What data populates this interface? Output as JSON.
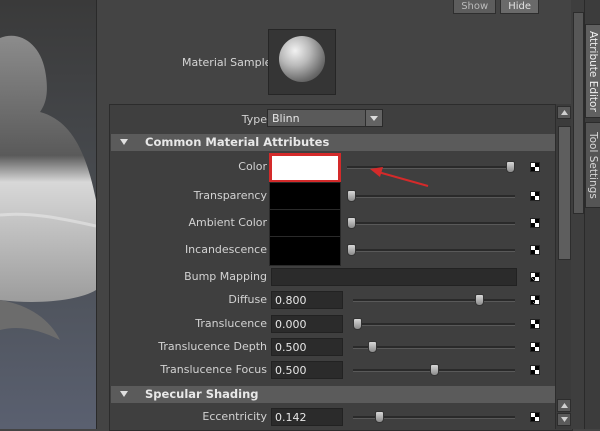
{
  "window": {
    "show_button": "Show",
    "hide_button": "Hide"
  },
  "material_sample": {
    "label": "Material Sample"
  },
  "type_field": {
    "label": "Type",
    "value": "Blinn"
  },
  "sections": {
    "common": "Common Material Attributes",
    "specular": "Specular Shading"
  },
  "attributes": [
    {
      "label": "Color",
      "kind": "swatch",
      "swatch_color": "#ffffff",
      "slider": 1.0,
      "highlighted": true
    },
    {
      "label": "Transparency",
      "kind": "swatch",
      "swatch_color": "#000000",
      "slider": 0.0
    },
    {
      "label": "Ambient Color",
      "kind": "swatch",
      "swatch_color": "#000000",
      "slider": 0.0
    },
    {
      "label": "Incandescence",
      "kind": "swatch",
      "swatch_color": "#000000",
      "slider": 0.0
    },
    {
      "label": "Bump Mapping",
      "kind": "field"
    },
    {
      "label": "Diffuse",
      "kind": "number",
      "value": "0.800",
      "slider": 0.8
    },
    {
      "label": "Translucence",
      "kind": "number",
      "value": "0.000",
      "slider": 0.0
    },
    {
      "label": "Translucence Depth",
      "kind": "number",
      "value": "0.500",
      "slider": 0.1
    },
    {
      "label": "Translucence Focus",
      "kind": "number",
      "value": "0.500",
      "slider": 0.5
    }
  ],
  "specular_attributes": [
    {
      "label": "Eccentricity",
      "kind": "number",
      "value": "0.142",
      "slider": 0.142
    }
  ],
  "side_tabs": {
    "attribute_editor": "Attribute Editor",
    "tool_settings": "Tool Settings"
  },
  "colors": {
    "highlight_red": "#d42a2a",
    "panel_bg": "#444444"
  },
  "icons": [
    "dropdown-arrow-icon",
    "collapse-triangle-icon",
    "map-checker-icon",
    "scroll-up-icon",
    "scroll-down-icon",
    "annotation-arrow-icon"
  ]
}
